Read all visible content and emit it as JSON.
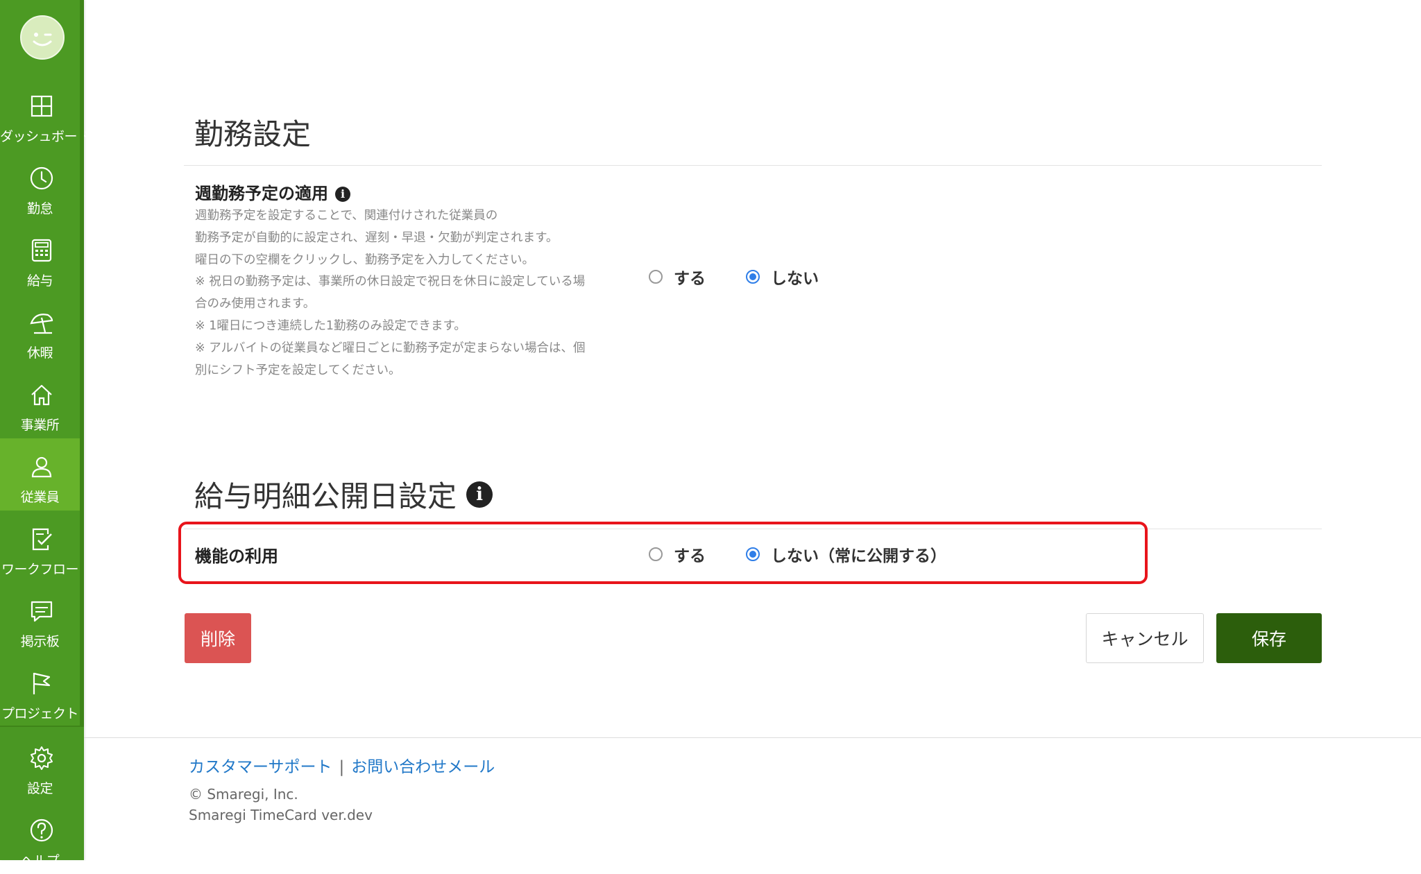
{
  "sidebar": {
    "items": [
      {
        "label": "ダッシュボード",
        "icon": "grid-icon"
      },
      {
        "label": "勤怠",
        "icon": "clock-icon"
      },
      {
        "label": "給与",
        "icon": "calculator-icon"
      },
      {
        "label": "休暇",
        "icon": "beach-umbrella-icon"
      },
      {
        "label": "事業所",
        "icon": "home-icon"
      },
      {
        "label": "従業員",
        "icon": "person-icon",
        "active": true
      },
      {
        "label": "ワークフロー",
        "icon": "checklist-icon"
      },
      {
        "label": "掲示板",
        "icon": "chat-icon"
      },
      {
        "label": "プロジェクト",
        "icon": "flag-icon"
      }
    ],
    "bottom_items": [
      {
        "label": "設定",
        "icon": "gear-icon"
      },
      {
        "label": "ヘルプ",
        "icon": "question-icon"
      }
    ]
  },
  "work_settings": {
    "title": "勤務設定",
    "weekly_schedule": {
      "label": "週勤務予定の適用",
      "description": [
        "週勤務予定を設定することで、関連付けされた従業員の",
        "勤務予定が自動的に設定され、遅刻・早退・欠勤が判定されます。",
        "曜日の下の空欄をクリックし、勤務予定を入力してください。",
        "※ 祝日の勤務予定は、事業所の休日設定で祝日を休日に設定している場",
        "合のみ使用されます。",
        "※ 1曜日につき連続した1勤務のみ設定できます。",
        "※ アルバイトの従業員など曜日ごとに勤務予定が定まらない場合は、個",
        "別にシフト予定を設定してください。"
      ],
      "option_yes": "する",
      "option_no": "しない",
      "selected": "しない"
    }
  },
  "payslip_settings": {
    "title": "給与明細公開日設定",
    "feature_use": {
      "label": "機能の利用",
      "option_yes": "する",
      "option_no": "しない（常に公開する）",
      "selected": "しない（常に公開する）"
    }
  },
  "buttons": {
    "delete": "削除",
    "cancel": "キャンセル",
    "save": "保存"
  },
  "footer": {
    "support_link": "カスタマーサポート",
    "separator": "|",
    "mail_link": "お問い合わせメール",
    "copyright": "© Smaregi, Inc.",
    "version": "Smaregi TimeCard ver.dev"
  },
  "colors": {
    "sidebar_bg": "#4c9a23",
    "sidebar_active": "#67b22b",
    "save_button": "#2c5e0c",
    "delete_button": "#db5453",
    "highlight_border": "#e8141b",
    "radio_checked": "#2f7ee8",
    "link": "#2178c8"
  }
}
